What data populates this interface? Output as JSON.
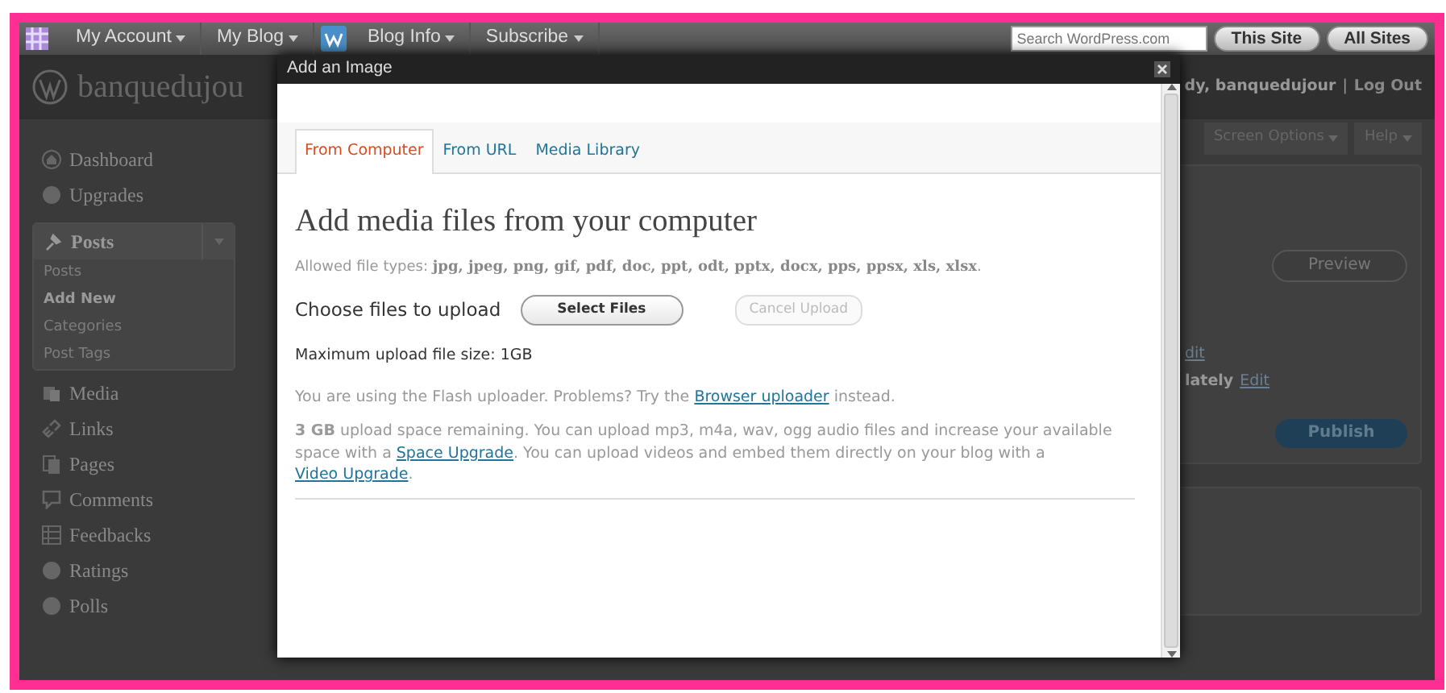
{
  "admin_bar": {
    "menus": [
      {
        "label": "My Account",
        "kind": "menu"
      },
      {
        "label": "My Blog",
        "kind": "menu"
      },
      {
        "label": "Blog Info",
        "kind": "blog"
      },
      {
        "label": "Subscribe",
        "kind": "menu"
      }
    ],
    "search": {
      "placeholder": "Search WordPress.com"
    },
    "buttons": [
      "This Site",
      "All Sites"
    ]
  },
  "header": {
    "site_title": "banquedujou",
    "greeting": "dy, banquedujour",
    "separator": "|",
    "logout": "Log Out"
  },
  "screen_tabs": [
    "Screen Options",
    "Help"
  ],
  "sidebar": {
    "items": [
      {
        "label": "Dashboard",
        "kind": "house",
        "expanded": false
      },
      {
        "label": "Upgrades",
        "kind": "circle",
        "expanded": false
      },
      {
        "label": "Posts",
        "kind": "pin",
        "expanded": true,
        "children": [
          {
            "label": "Posts",
            "selected": false
          },
          {
            "label": "Add New",
            "selected": true
          },
          {
            "label": "Categories",
            "selected": false
          },
          {
            "label": "Post Tags",
            "selected": false
          }
        ]
      },
      {
        "label": "Media",
        "kind": "media",
        "expanded": false
      },
      {
        "label": "Links",
        "kind": "link",
        "expanded": false
      },
      {
        "label": "Pages",
        "kind": "pages",
        "expanded": false
      },
      {
        "label": "Comments",
        "kind": "comment",
        "expanded": false
      },
      {
        "label": "Feedbacks",
        "kind": "table",
        "expanded": false
      },
      {
        "label": "Ratings",
        "kind": "circle",
        "expanded": false
      },
      {
        "label": "Polls",
        "kind": "circle",
        "expanded": false
      }
    ]
  },
  "publish_box": {
    "preview": "Preview",
    "edit_link": "dit",
    "schedule_label": "lately",
    "schedule_link": "Edit",
    "publish": "Publish"
  },
  "modal": {
    "title": "Add an Image",
    "tabs": [
      {
        "label": "From Computer",
        "selected": true
      },
      {
        "label": "From URL",
        "selected": false
      },
      {
        "label": "Media Library",
        "selected": false
      }
    ],
    "heading": "Add media files from your computer",
    "allowed": "Allowed file types: **jpg, jpeg, png, gif, pdf, doc, ppt, odt, pptx, docx, pps, ppsx, xls, xlsx**.",
    "choose_label": "Choose files to upload",
    "select_button": {
      "label": "Select Files",
      "disabled": false
    },
    "cancel_button": {
      "label": "Cancel Upload",
      "disabled": true
    },
    "max_size": "Maximum upload file size: 1GB",
    "flash_note": [
      {
        "kind": "text",
        "text": "You are using the Flash uploader. Problems? Try the "
      },
      {
        "kind": "link",
        "text": "Browser uploader"
      },
      {
        "kind": "text",
        "text": " instead."
      }
    ],
    "space_note": [
      {
        "kind": "text",
        "text": "**3 GB** upload space remaining. You can upload mp3, m4a, wav, ogg audio files and increase your available space with a "
      },
      {
        "kind": "link",
        "text": "Space Upgrade"
      },
      {
        "kind": "text",
        "text": ". You can upload videos and embed them directly on your blog with a "
      },
      {
        "kind": "link",
        "text": "Video Upgrade"
      },
      {
        "kind": "text",
        "text": "."
      }
    ]
  }
}
